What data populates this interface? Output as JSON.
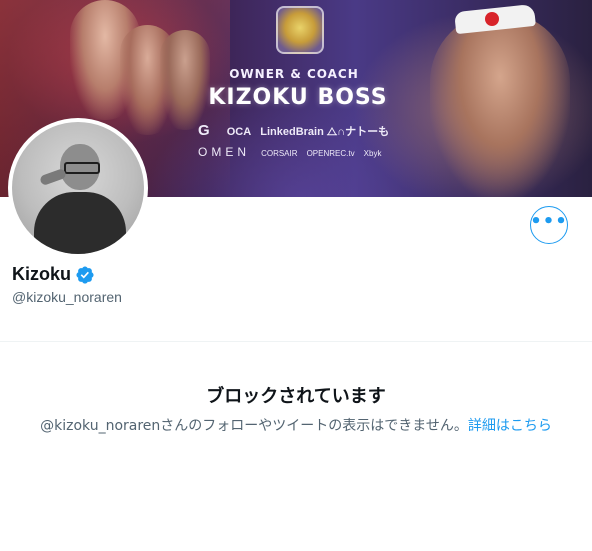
{
  "banner": {
    "owner_title": "OWNER & COACH",
    "boss_name": "KIZOKU BOSS",
    "sponsor_g": "G",
    "sponsor_oca": "OCA",
    "sponsor_linkedbrain": "LinkedBrain",
    "sponsor_misc": "⧍∩ナトーも",
    "sponsor_omen": "OMEN",
    "sponsor_corsair": "CORSAIR",
    "sponsor_openrec": "OPENREC.tv",
    "sponsor_tiny": "Xbyk"
  },
  "profile": {
    "display_name": "Kizoku",
    "handle": "@kizoku_noraren",
    "verified": true
  },
  "actions": {
    "more_label": "•••"
  },
  "blocked": {
    "title": "ブロックされています",
    "message": "@kizoku_norarenさんのフォローやツイートの表示はできません。",
    "link_text": "詳細はこちら"
  },
  "colors": {
    "accent": "#1d9bf0",
    "text_primary": "#0f1419",
    "text_secondary": "#536471",
    "divider": "#eff3f4"
  }
}
